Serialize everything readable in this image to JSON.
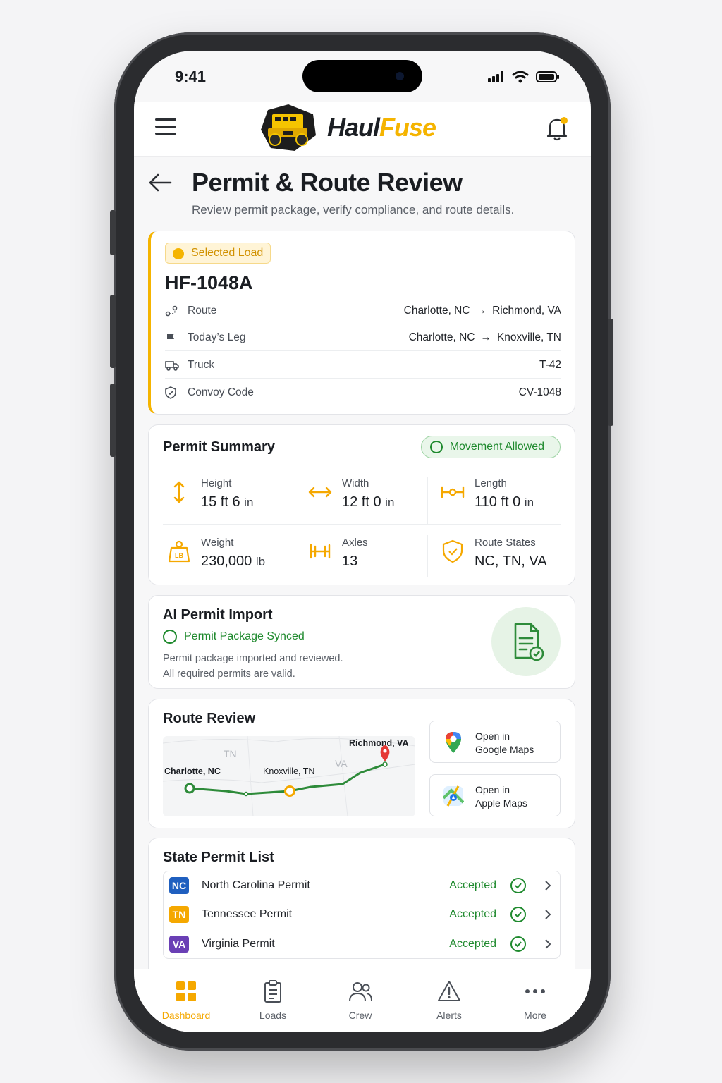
{
  "status": {
    "time": "9:41"
  },
  "app": {
    "name_part1": "Haul",
    "name_part2": "Fuse"
  },
  "page": {
    "title": "Permit & Route Review",
    "subtitle": "Review permit package, verify compliance, and route details."
  },
  "load": {
    "badge": "Selected Load",
    "id": "HF-1048A",
    "rows": [
      {
        "label": "Route",
        "from": "Charlotte, NC",
        "to": "Richmond, VA",
        "icon": "route-icon"
      },
      {
        "label": "Today’s Leg",
        "from": "Charlotte, NC",
        "to": "Knoxville, TN",
        "icon": "flag-icon"
      },
      {
        "label": "Truck",
        "value": "T-42",
        "icon": "truck-icon"
      },
      {
        "label": "Convoy Code",
        "value": "CV-1048",
        "icon": "shield-icon"
      }
    ]
  },
  "summary": {
    "title": "Permit Summary",
    "status": "Movement Allowed",
    "metrics": [
      {
        "label": "Height",
        "value": "15 ft 6",
        "unit": "in"
      },
      {
        "label": "Width",
        "value": "12 ft 0",
        "unit": "in"
      },
      {
        "label": "Length",
        "value": "110 ft 0",
        "unit": "in"
      },
      {
        "label": "Weight",
        "value": "230,000",
        "unit": "lb"
      },
      {
        "label": "Axles",
        "value": "13",
        "unit": ""
      },
      {
        "label": "Route States",
        "value": "NC, TN, VA",
        "unit": ""
      }
    ],
    "weight_icon_text": "LB"
  },
  "ai_import": {
    "title": "AI Permit Import",
    "status": "Permit Package Synced",
    "desc_line1": "Permit package imported and reviewed.",
    "desc_line2": "All required permits are valid."
  },
  "route_review": {
    "title": "Route Review",
    "map_labels": {
      "start": "Charlotte, NC",
      "mid": "Knoxville, TN",
      "end": "Richmond, VA",
      "state_tn": "TN",
      "state_va": "VA"
    },
    "google": {
      "line1": "Open in",
      "line2": "Google Maps"
    },
    "apple": {
      "line1": "Open in",
      "line2": "Apple Maps"
    }
  },
  "permits": {
    "title": "State Permit List",
    "items": [
      {
        "code": "NC",
        "name": "North Carolina Permit",
        "status": "Accepted",
        "color": "#1f5fbf"
      },
      {
        "code": "TN",
        "name": "Tennessee Permit",
        "status": "Accepted",
        "color": "#f5a800"
      },
      {
        "code": "VA",
        "name": "Virginia Permit",
        "status": "Accepted",
        "color": "#6a3fb5"
      }
    ]
  },
  "tabs": [
    {
      "label": "Dashboard",
      "icon": "dashboard-icon"
    },
    {
      "label": "Loads",
      "icon": "clipboard-icon"
    },
    {
      "label": "Crew",
      "icon": "users-icon"
    },
    {
      "label": "Alerts",
      "icon": "alert-icon"
    },
    {
      "label": "More",
      "icon": "more-icon"
    }
  ],
  "colors": {
    "accent": "#f5b400",
    "success": "#1f8a2e",
    "text": "#1c1f24"
  }
}
